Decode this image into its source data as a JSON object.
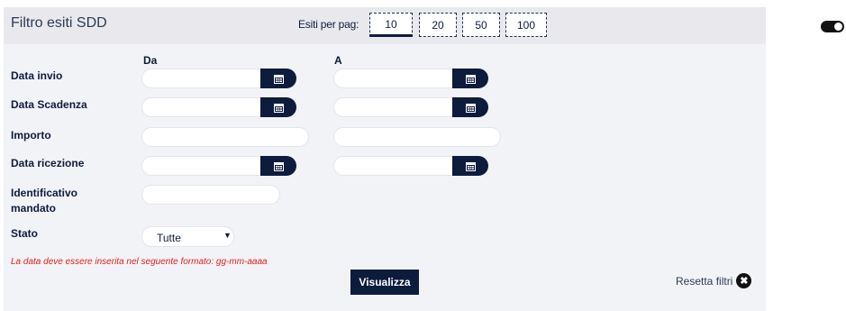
{
  "header": {
    "title": "Filtro esiti SDD",
    "per_page_label": "Esiti per pag:",
    "per_page_options": [
      "10",
      "20",
      "50",
      "100"
    ],
    "per_page_selected": "10"
  },
  "columns": {
    "from": "Da",
    "to": "A"
  },
  "fields": {
    "data_invio": {
      "label": "Data invio",
      "from_value": "",
      "to_value": ""
    },
    "data_scadenza": {
      "label": "Data Scadenza",
      "from_value": "",
      "to_value": ""
    },
    "importo": {
      "label": "Importo",
      "from_value": "",
      "to_value": ""
    },
    "data_ricezione": {
      "label": "Data ricezione",
      "from_value": "",
      "to_value": ""
    },
    "identificativo_mandato": {
      "label_line1": "Identificativo",
      "label_line2": "mandato",
      "value": ""
    },
    "stato": {
      "label": "Stato",
      "selected": "Tutte"
    }
  },
  "error_message": "La data deve essere inserita nel seguente formato: gg-mm-aaaa",
  "actions": {
    "visualizza_label": "Visualizza",
    "reset_label": "Resetta filtri"
  },
  "colors": {
    "navy": "#0d1b3d",
    "panel_bg": "#f2f3f7",
    "header_bg": "#e9e9ed",
    "error": "#e02020"
  },
  "icons": {
    "calendar": "calendar-icon",
    "reset": "close-circle-icon",
    "toggle": "toggle-switch"
  }
}
